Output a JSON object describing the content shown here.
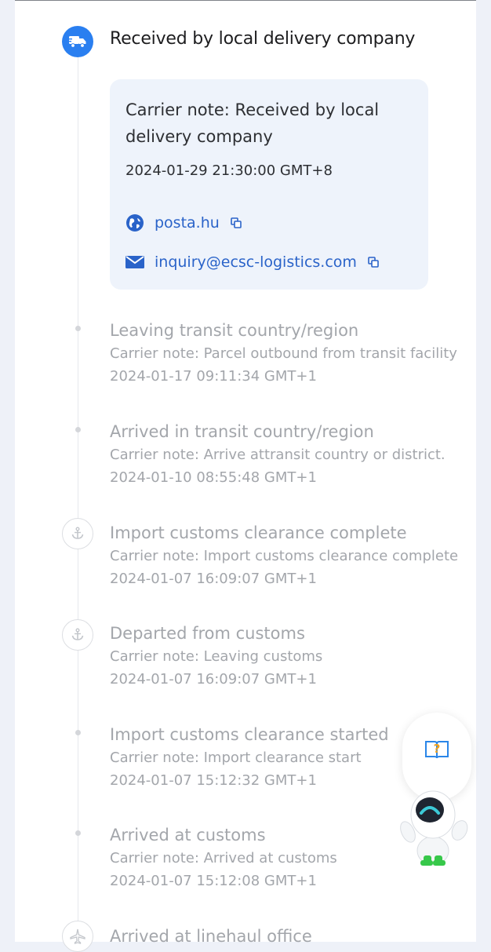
{
  "current_event": {
    "title": "Received by local delivery company",
    "icon": "truck-icon",
    "note": "Carrier note: Received by local delivery company",
    "time": "2024-01-29 21:30:00 GMT+8",
    "website": "posta.hu",
    "email": "inquiry@ecsc-logistics.com"
  },
  "events": [
    {
      "title": "Leaving transit country/region",
      "note": "Carrier note: Parcel outbound from transit facility",
      "time": "2024-01-17 09:11:34 GMT+1",
      "icon": "dot"
    },
    {
      "title": "Arrived in transit country/region",
      "note": "Carrier note: Arrive attransit country or district.",
      "time": "2024-01-10 08:55:48 GMT+1",
      "icon": "dot"
    },
    {
      "title": "Import customs clearance complete",
      "note": "Carrier note: Import customs clearance complete",
      "time": "2024-01-07 16:09:07 GMT+1",
      "icon": "anchor-icon"
    },
    {
      "title": "Departed from customs",
      "note": "Carrier note: Leaving customs",
      "time": "2024-01-07 16:09:07 GMT+1",
      "icon": "anchor-icon"
    },
    {
      "title": "Import customs clearance started",
      "note": "Carrier note: Import clearance start",
      "time": "2024-01-07 15:12:32 GMT+1",
      "icon": "dot"
    },
    {
      "title": "Arrived at customs",
      "note": "Carrier note: Arrived at customs",
      "time": "2024-01-07 15:12:08 GMT+1",
      "icon": "dot"
    },
    {
      "title": "Arrived at linehaul office",
      "icon": "airplane-icon"
    }
  ],
  "colors": {
    "accent": "#2a7ff0",
    "link": "#2a63c9",
    "muted_text": "#a3a6ab",
    "note_bg": "#eef3fb"
  }
}
